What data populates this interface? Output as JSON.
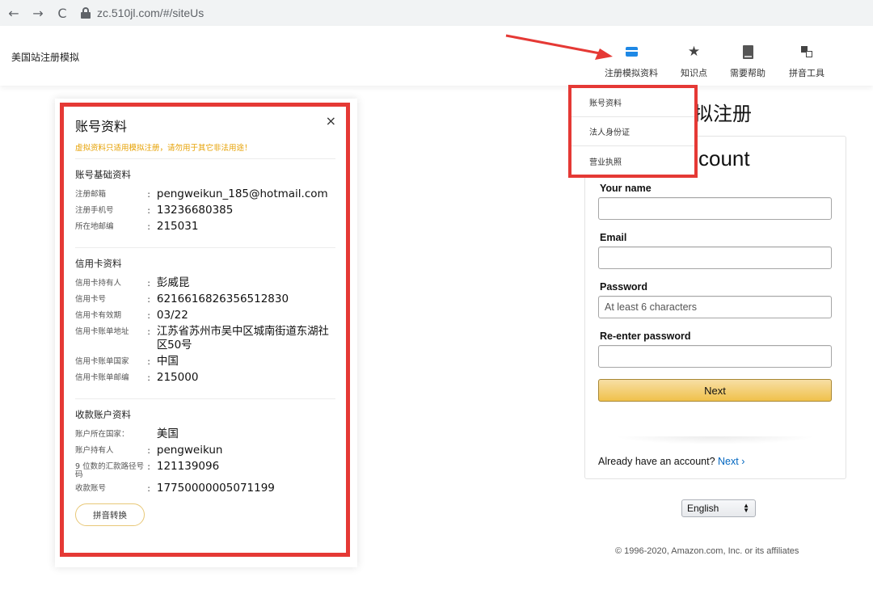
{
  "browser": {
    "back": "←",
    "forward": "→",
    "reload": "C",
    "url": "zc.510jl.com/#/siteUs"
  },
  "header": {
    "site_title": "美国站注册模拟",
    "nav": [
      {
        "label": "注册模拟资料",
        "icon": "card-icon"
      },
      {
        "label": "知识点",
        "icon": "star-icon"
      },
      {
        "label": "需要帮助",
        "icon": "book-icon"
      },
      {
        "label": "拼音工具",
        "icon": "translate-icon"
      }
    ]
  },
  "dropdown": {
    "items": [
      "账号资料",
      "法人身份证",
      "营业执照"
    ]
  },
  "panel": {
    "title": "账号资料",
    "close": "×",
    "warning": "虚拟资料只适用模拟注册，请勿用于其它非法用途！",
    "sections": [
      {
        "title": "账号基础资料",
        "rows": [
          {
            "key": "注册邮箱",
            "value": "pengweikun_185@hotmail.com"
          },
          {
            "key": "注册手机号",
            "value": "13236680385"
          },
          {
            "key": "所在地邮编",
            "value": "215031"
          }
        ]
      },
      {
        "title": "信用卡资料",
        "rows": [
          {
            "key": "信用卡持有人",
            "value": "彭威昆"
          },
          {
            "key": "信用卡号",
            "value": "6216616826356512830"
          },
          {
            "key": "信用卡有效期",
            "value": "03/22"
          },
          {
            "key": "信用卡账单地址",
            "value": "江苏省苏州市吴中区城南街道东湖社区50号"
          },
          {
            "key": "信用卡账单国家",
            "value": "中国"
          },
          {
            "key": "信用卡账单邮编",
            "value": "215000"
          }
        ]
      },
      {
        "title": "收款账户资料",
        "rows": [
          {
            "key": "账户所在国家：",
            "value": "美国"
          },
          {
            "key": "账户持有人",
            "value": "pengweikun"
          },
          {
            "key": "9 位数的汇款路径号码",
            "value": "121139096"
          },
          {
            "key": "收款账号",
            "value": "17750000005071199"
          }
        ]
      }
    ],
    "colon": ":",
    "pinyin_button": "拼音转换"
  },
  "registration": {
    "big_heading": "拟注册",
    "form_heading": "count",
    "your_name_label": "Your name",
    "email_label": "Email",
    "password_label": "Password",
    "password_placeholder": "At least 6 characters",
    "reenter_label": "Re-enter password",
    "next_button": "Next",
    "already_text": "Already have an account?",
    "already_link": "Next ›",
    "language": "English",
    "copyright": "© 1996-2020, Amazon.com, Inc. or its affiliates"
  },
  "colors": {
    "highlight_red": "#e53935",
    "warning_orange": "#e6a000",
    "accent_blue": "#1e88e5",
    "amazon_button": "#f0c14b",
    "link_blue": "#0066c0"
  }
}
